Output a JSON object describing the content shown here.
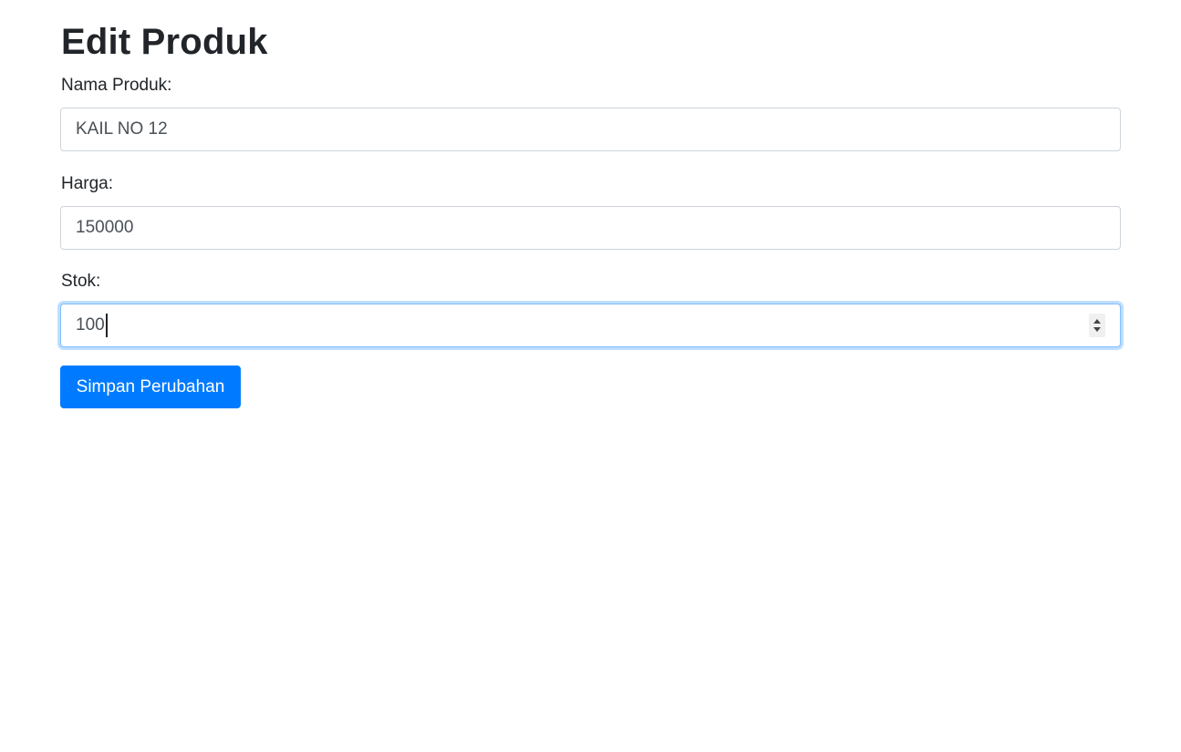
{
  "page": {
    "title": "Edit Produk"
  },
  "form": {
    "nama": {
      "label": "Nama Produk:",
      "value": "KAIL NO 12"
    },
    "harga": {
      "label": "Harga:",
      "value": "150000"
    },
    "stok": {
      "label": "Stok:",
      "value": "100"
    },
    "submit_label": "Simpan Perubahan"
  },
  "colors": {
    "primary": "#007bff",
    "focus_border": "#80bdff",
    "input_border": "#ced4da",
    "text": "#212529"
  },
  "icons": {
    "stok_spinner": "number-spinner-icon"
  }
}
